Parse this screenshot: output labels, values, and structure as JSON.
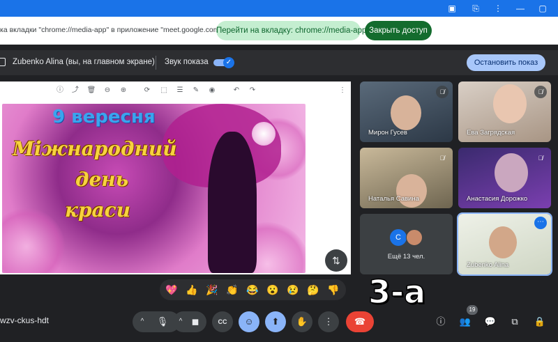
{
  "window": {
    "controls": [
      "▣",
      "⎘",
      "⋮",
      "—",
      "▢"
    ]
  },
  "share_bar": {
    "message": "ка вкладки \"chrome://media-app\" в приложение \"meet.google.com\"...",
    "goto_button": "Перейти на вкладку: chrome://media-app",
    "stop_access_button": "Закрыть доступ"
  },
  "presenting_bar": {
    "presenter": "Zubenko Alina (вы, на главном экране)",
    "sound_label": "Звук показа",
    "stop_button": "Остановить показ"
  },
  "slide_toolbar": [
    "ⓘ",
    "⤴",
    "🗑",
    "⊖",
    "⊕",
    "⟳",
    "⬚",
    "☰",
    "✎",
    "◉",
    "↶",
    "↷",
    "⋮"
  ],
  "slide": {
    "title": "9 вересня",
    "line1": "Міжнародний",
    "line2": "день",
    "line3": "краси"
  },
  "participants": [
    {
      "name": "Мирон Гусев",
      "muted": true
    },
    {
      "name": "Ева Загрядская",
      "muted": true
    },
    {
      "name": "Наталья Савина",
      "muted": true
    },
    {
      "name": "Анастасия Дорожко",
      "muted": true
    },
    {
      "more_label": "Ещё 13 чел.",
      "avatar_letter": "С"
    },
    {
      "name": "Zubenko Alina",
      "menu": "⋯"
    }
  ],
  "reactions": [
    "💖",
    "👍",
    "🎉",
    "👏",
    "😂",
    "😮",
    "😢",
    "🤔",
    "👎"
  ],
  "overlay_text": "3-а",
  "meeting_code": "wzv-ckus-hdt",
  "controls": {
    "mic_chevron": "^",
    "mic_icon": "🎙",
    "cam_chevron": "^",
    "cam_icon": "◼",
    "captions_icon": "CC",
    "emoji_icon": "☺",
    "present_icon": "⬆",
    "hand_icon": "✋",
    "more_icon": "⋮",
    "leave_icon": "☎"
  },
  "right_icons": {
    "info": "ⓘ",
    "people": "👥",
    "people_count": "19",
    "chat": "💬",
    "activities": "⧉",
    "host": "🔒"
  }
}
